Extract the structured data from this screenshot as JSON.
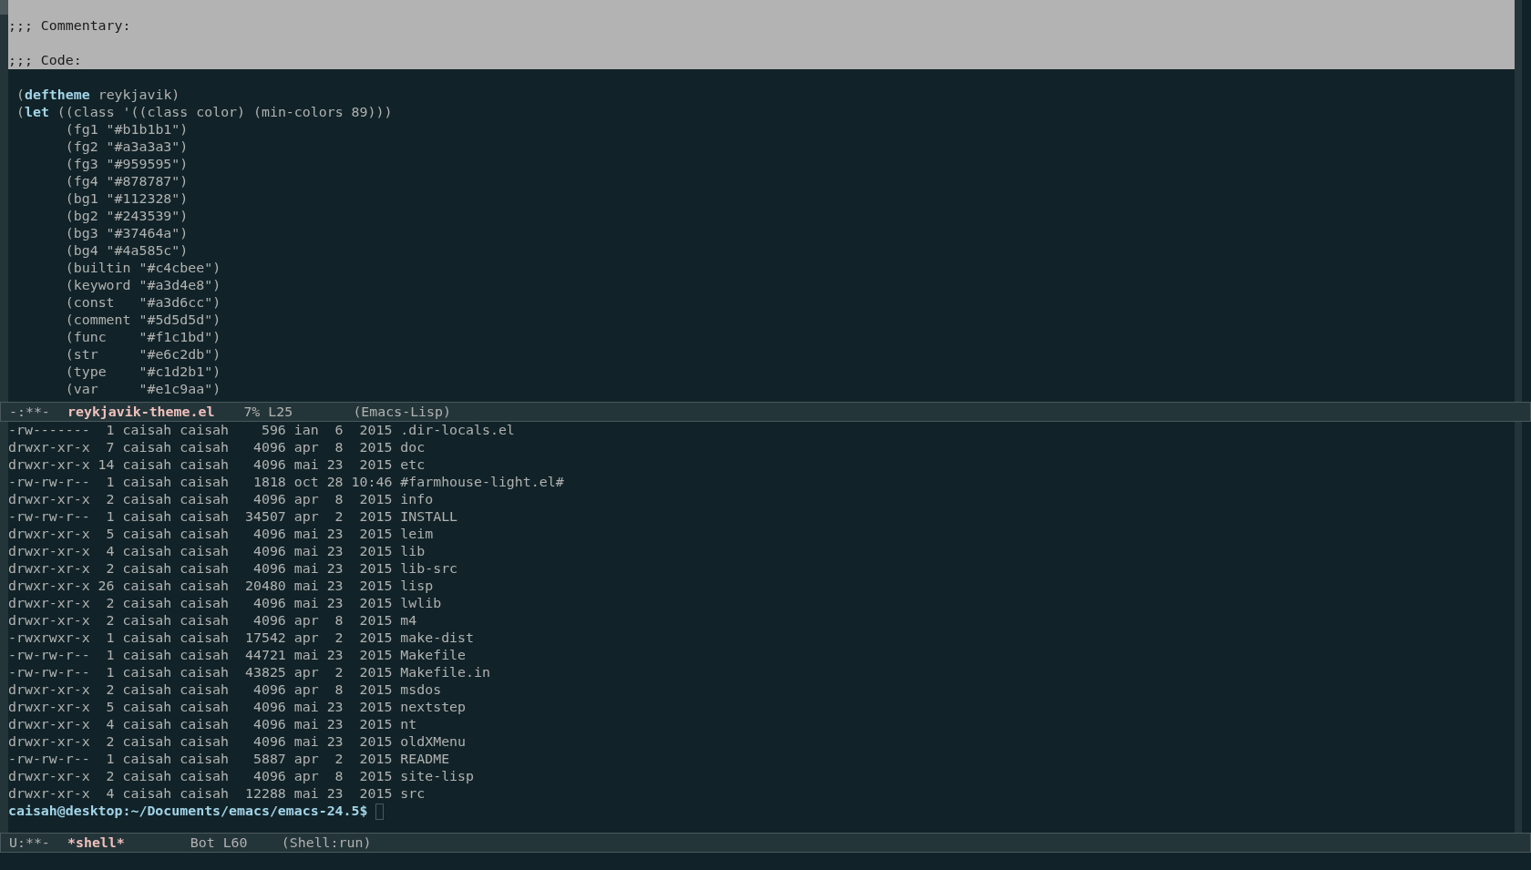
{
  "editor_window": {
    "selected_region": [
      ";;; Commentary:",
      ";;; Code:"
    ],
    "code_lines": [
      [
        {
          "text": "(",
          "kind": "plain"
        },
        {
          "text": "deftheme",
          "kind": "keyword"
        },
        {
          "text": " reykjavik)",
          "kind": "plain"
        }
      ],
      [
        {
          "text": "(",
          "kind": "plain"
        },
        {
          "text": "let",
          "kind": "keyword"
        },
        {
          "text": " ((class '((class color) (min-colors 89)))",
          "kind": "plain"
        }
      ],
      [
        {
          "text": "      (fg1 \"#b1b1b1\")",
          "kind": "plain"
        }
      ],
      [
        {
          "text": "      (fg2 \"#a3a3a3\")",
          "kind": "plain"
        }
      ],
      [
        {
          "text": "      (fg3 \"#959595\")",
          "kind": "plain"
        }
      ],
      [
        {
          "text": "      (fg4 \"#878787\")",
          "kind": "plain"
        }
      ],
      [
        {
          "text": "      (bg1 \"#112328\")",
          "kind": "plain"
        }
      ],
      [
        {
          "text": "      (bg2 \"#243539\")",
          "kind": "plain"
        }
      ],
      [
        {
          "text": "      (bg3 \"#37464a\")",
          "kind": "plain"
        }
      ],
      [
        {
          "text": "      (bg4 \"#4a585c\")",
          "kind": "plain"
        }
      ],
      [
        {
          "text": "      (builtin \"#c4cbee\")",
          "kind": "plain"
        }
      ],
      [
        {
          "text": "      (keyword \"#a3d4e8\")",
          "kind": "plain"
        }
      ],
      [
        {
          "text": "      (const   \"#a3d6cc\")",
          "kind": "plain"
        }
      ],
      [
        {
          "text": "      (comment \"#5d5d5d\")",
          "kind": "plain"
        }
      ],
      [
        {
          "text": "      (func    \"#f1c1bd\")",
          "kind": "plain"
        }
      ],
      [
        {
          "text": "      (str     \"#e6c2db\")",
          "kind": "plain"
        }
      ],
      [
        {
          "text": "      (type    \"#c1d2b1\")",
          "kind": "plain"
        }
      ],
      [
        {
          "text": "      (var     \"#e1c9aa\")",
          "kind": "plain"
        }
      ]
    ],
    "mode_line": {
      "state": "-:**-",
      "buffer": "reykjavik-theme.el",
      "position": "7% L25",
      "mode": "(Emacs-Lisp)"
    }
  },
  "shell_window": {
    "output_lines": [
      "-rw-------  1 caisah caisah    596 ian  6  2015 .dir-locals.el",
      "drwxr-xr-x  7 caisah caisah   4096 apr  8  2015 doc",
      "drwxr-xr-x 14 caisah caisah   4096 mai 23  2015 etc",
      "-rw-rw-r--  1 caisah caisah   1818 oct 28 10:46 #farmhouse-light.el#",
      "drwxr-xr-x  2 caisah caisah   4096 apr  8  2015 info",
      "-rw-rw-r--  1 caisah caisah  34507 apr  2  2015 INSTALL",
      "drwxr-xr-x  5 caisah caisah   4096 mai 23  2015 leim",
      "drwxr-xr-x  4 caisah caisah   4096 mai 23  2015 lib",
      "drwxr-xr-x  2 caisah caisah   4096 mai 23  2015 lib-src",
      "drwxr-xr-x 26 caisah caisah  20480 mai 23  2015 lisp",
      "drwxr-xr-x  2 caisah caisah   4096 mai 23  2015 lwlib",
      "drwxr-xr-x  2 caisah caisah   4096 apr  8  2015 m4",
      "-rwxrwxr-x  1 caisah caisah  17542 apr  2  2015 make-dist",
      "-rw-rw-r--  1 caisah caisah  44721 mai 23  2015 Makefile",
      "-rw-rw-r--  1 caisah caisah  43825 apr  2  2015 Makefile.in",
      "drwxr-xr-x  2 caisah caisah   4096 apr  8  2015 msdos",
      "drwxr-xr-x  5 caisah caisah   4096 mai 23  2015 nextstep",
      "drwxr-xr-x  4 caisah caisah   4096 mai 23  2015 nt",
      "drwxr-xr-x  2 caisah caisah   4096 mai 23  2015 oldXMenu",
      "-rw-rw-r--  1 caisah caisah   5887 apr  2  2015 README",
      "drwxr-xr-x  2 caisah caisah   4096 apr  8  2015 site-lisp",
      "drwxr-xr-x  4 caisah caisah  12288 mai 23  2015 src"
    ],
    "prompt": "caisah@desktop:~/Documents/emacs/emacs-24.5$",
    "mode_line": {
      "state": "U:**-",
      "buffer": "*shell*",
      "position": "Bot L60",
      "mode": "(Shell:run)"
    }
  }
}
